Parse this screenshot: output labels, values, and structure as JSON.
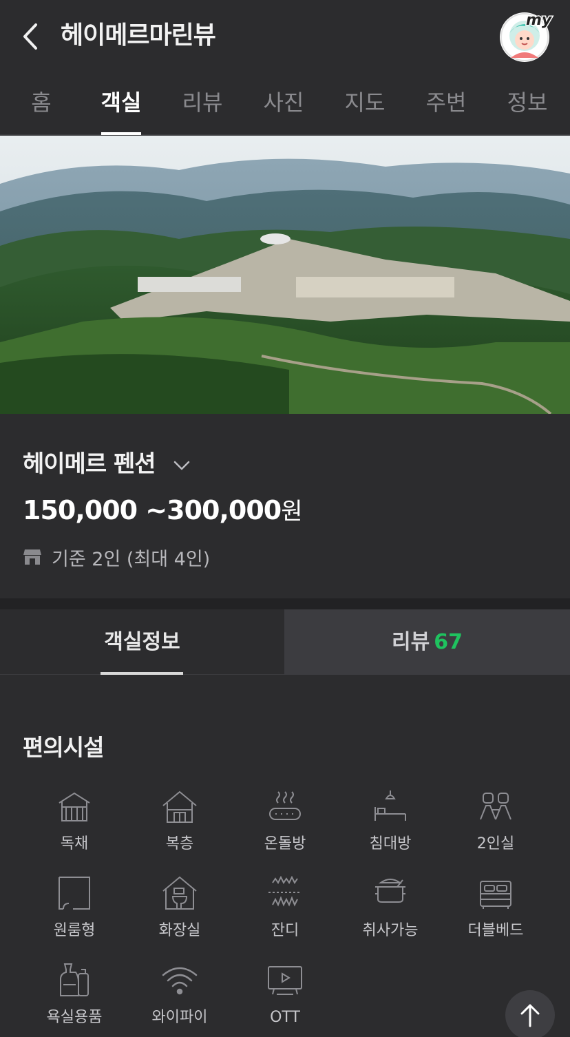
{
  "header": {
    "title": "헤이메르마린뷰",
    "avatar_badge": "my"
  },
  "tabs": [
    {
      "label": "홈"
    },
    {
      "label": "객실"
    },
    {
      "label": "리뷰"
    },
    {
      "label": "사진"
    },
    {
      "label": "지도"
    },
    {
      "label": "주변"
    },
    {
      "label": "정보"
    }
  ],
  "active_tab": "객실",
  "room": {
    "name": "헤이메르 펜션",
    "price_range": "150,000 ~300,000",
    "price_unit": "원",
    "capacity": "기준 2인 (최대 4인)"
  },
  "sub_tabs": {
    "info_label": "객실정보",
    "review_label": "리뷰",
    "review_count": "67"
  },
  "amenities": {
    "title": "편의시설",
    "items": [
      {
        "label": "독채",
        "icon": "detached-house-icon"
      },
      {
        "label": "복층",
        "icon": "duplex-icon"
      },
      {
        "label": "온돌방",
        "icon": "ondol-icon"
      },
      {
        "label": "침대방",
        "icon": "bedroom-icon"
      },
      {
        "label": "2인실",
        "icon": "two-person-icon"
      },
      {
        "label": "원룸형",
        "icon": "one-room-icon"
      },
      {
        "label": "화장실",
        "icon": "toilet-icon"
      },
      {
        "label": "잔디",
        "icon": "grass-icon"
      },
      {
        "label": "취사가능",
        "icon": "cooking-pot-icon"
      },
      {
        "label": "더블베드",
        "icon": "double-bed-icon"
      },
      {
        "label": "욕실용품",
        "icon": "toiletries-icon"
      },
      {
        "label": "와이파이",
        "icon": "wifi-icon"
      },
      {
        "label": "OTT",
        "icon": "tv-play-icon"
      }
    ]
  },
  "colors": {
    "background": "#2c2c2e",
    "accent_green": "#1fc25f",
    "text_muted": "#8a8a8e"
  }
}
